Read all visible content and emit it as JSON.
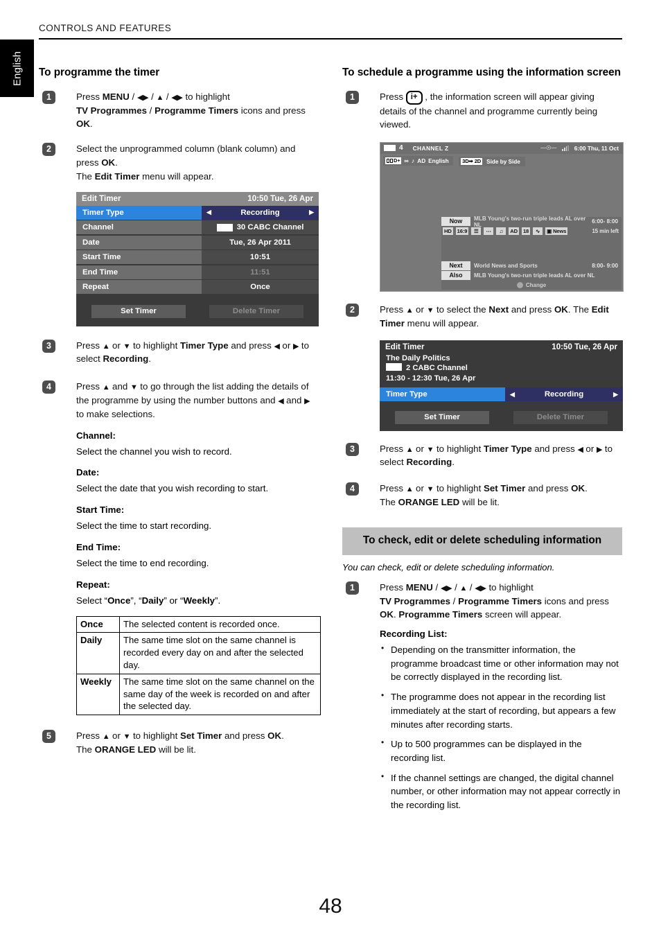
{
  "header": {
    "running_title": "CONTROLS AND FEATURES"
  },
  "lang_tab": {
    "label": "English"
  },
  "page_number": "48",
  "left": {
    "heading": "To programme the timer",
    "steps": [
      {
        "num": "1",
        "html": "Press <b>MENU</b> / <span class=\"arrow\">◀▶</span> / <span class=\"arrow\">▲</span> / <span class=\"arrow\">◀▶</span> to highlight <br><b>TV Programmes</b> / <b>Programme Timers</b> icons and press <b>OK</b>."
      },
      {
        "num": "2",
        "html": "Select the unprogrammed column (blank column) and press <b>OK</b>.<br>The <b>Edit Timer</b> menu will appear."
      },
      {
        "num": "3",
        "html": "Press <span class=\"arrow\">▲</span> or <span class=\"arrow\">▼</span> to highlight <b>Timer Type</b> and press <span class=\"arrow\">◀</span> or <span class=\"arrow\">▶</span> to select <b>Recording</b>."
      },
      {
        "num": "4",
        "html": "Press <span class=\"arrow\">▲</span> and <span class=\"arrow\">▼</span> to go through the list adding the details of the programme by using the number buttons and <span class=\"arrow\">◀</span> and <span class=\"arrow\">▶</span> to make selections."
      },
      {
        "num": "5",
        "html": "Press <span class=\"arrow\">▲</span> or <span class=\"arrow\">▼</span> to highlight <b>Set Timer</b> and press <b>OK</b>.<br>The <b>ORANGE LED</b> will be lit."
      }
    ],
    "field_defs": [
      {
        "head": "Channel:",
        "body": "Select the channel you wish to record."
      },
      {
        "head": "Date:",
        "body": "Select the date that you wish recording to start."
      },
      {
        "head": "Start Time:",
        "body": "Select the time to start recording."
      },
      {
        "head": "End Time:",
        "body": "Select the time to end recording."
      },
      {
        "head": "Repeat:",
        "body": ""
      }
    ],
    "repeat_select_html": "Select “<b>Once</b>”, “<b>Daily</b>” or “<b>Weekly</b>”.",
    "repeat_table": [
      {
        "key": "Once",
        "desc": "The selected content is recorded once."
      },
      {
        "key": "Daily",
        "desc": "The same time slot on the same channel is recorded every day on and after the selected day."
      },
      {
        "key": "Weekly",
        "desc": "The same time slot on the same channel on the same day of the week is recorded on and after the selected day."
      }
    ]
  },
  "edit_timer_osd": {
    "title": "Edit Timer",
    "clock": "10:50 Tue, 26 Apr",
    "rows": [
      {
        "label": "Timer Type",
        "value": "Recording",
        "selected": true,
        "dim": false
      },
      {
        "label": "Channel",
        "value": "30 CABC Channel",
        "selected": false,
        "dim": false,
        "channel_icon": true
      },
      {
        "label": "Date",
        "value": "Tue, 26 Apr 2011",
        "selected": false,
        "dim": false
      },
      {
        "label": "Start Time",
        "value": "10:51",
        "selected": false,
        "dim": false
      },
      {
        "label": "End Time",
        "value": "11:51",
        "selected": false,
        "dim": true
      },
      {
        "label": "Repeat",
        "value": "Once",
        "selected": false,
        "dim": false
      }
    ],
    "set_button": "Set Timer",
    "delete_button": "Delete Timer"
  },
  "right": {
    "heading": "To schedule a programme using the information screen",
    "steps": [
      {
        "num": "1",
        "html": "Press <span class=\"info-key\">i+</span> , the information screen will appear giving details of the channel and programme currently being viewed."
      },
      {
        "num": "2",
        "html": "Press <span class=\"arrow\">▲</span> or <span class=\"arrow\">▼</span> to select the <b>Next</b> and press <b>OK</b>. The <b>Edit Timer</b> menu will appear."
      },
      {
        "num": "3",
        "html": "Press <span class=\"arrow\">▲</span> or <span class=\"arrow\">▼</span> to highlight <b>Timer Type</b> and press <span class=\"arrow\">◀</span> or <span class=\"arrow\">▶</span> to select <b>Recording</b>."
      },
      {
        "num": "4",
        "html": "Press <span class=\"arrow\">▲</span> or <span class=\"arrow\">▼</span> to highlight <b>Set Timer</b> and press <b>OK</b>.<br>The <b>ORANGE LED</b> will be lit."
      }
    ],
    "banner": "To check, edit or delete scheduling information",
    "banner_note": "You can check, edit or delete scheduling information.",
    "check_step": {
      "num": "1",
      "html": "Press <b>MENU</b> / <span class=\"arrow\">◀▶</span> / <span class=\"arrow\">▲</span> / <span class=\"arrow\">◀▶</span> to highlight <br><b>TV Programmes</b> / <b>Programme Timers</b> icons and press <b>OK</b>. <b>Programme Timers</b> screen will appear."
    },
    "recording_list_heading": "Recording List:",
    "recording_list_bullets": [
      "Depending on the transmitter information, the programme broadcast time or other information may not be correctly displayed in the recording list.",
      "The programme does not appear in the recording list immediately at the start of recording, but appears a few minutes after recording starts.",
      "Up to 500 programmes can be displayed in the recording list.",
      "If the channel settings are changed, the digital channel number, or other information may not appear correctly in the recording list."
    ]
  },
  "info_screen": {
    "channel_number": "4",
    "channel_name": "CHANNEL Z",
    "clock": "6:00 Thu, 11 Oct",
    "audio_tags": {
      "dolby": "D+",
      "ad": "AD",
      "language": "English"
    },
    "three_d": {
      "mode": "3D➡ 2D",
      "format": "Side by Side"
    },
    "now": {
      "pill": "Now",
      "title": "MLB Young's two-run triple leads AL over NL",
      "time": "6:00- 8:00"
    },
    "now_icons": [
      "HD",
      "16:9",
      "subtitle",
      "teletext",
      "audio",
      "AD",
      "18",
      "rating",
      "News"
    ],
    "now_icon_labels": {
      "hd": "HD",
      "aspect": "16:9",
      "ad": "AD",
      "age": "18",
      "genre": "News"
    },
    "time_left": "15 min left",
    "next": {
      "pill": "Next",
      "title": "World News and Sports",
      "time": "8:00- 9:00"
    },
    "also": {
      "pill": "Also",
      "title": "MLB Young's two-run triple leads AL over NL"
    },
    "footer": "Change"
  },
  "edit_timer_osd2": {
    "title": "Edit Timer",
    "clock": "10:50 Tue, 26 Apr",
    "programme": "The Daily Politics",
    "channel": "2 CABC Channel",
    "timespan": "11:30 - 12:30 Tue, 26 Apr",
    "row": {
      "label": "Timer Type",
      "value": "Recording"
    },
    "set_button": "Set Timer",
    "delete_button": "Delete Timer"
  }
}
